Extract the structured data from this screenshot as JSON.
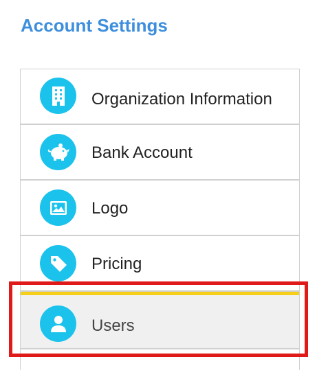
{
  "page": {
    "title": "Account Settings"
  },
  "menu": {
    "items": [
      {
        "label": "Organization Information",
        "icon": "building-icon"
      },
      {
        "label": "Bank Account",
        "icon": "piggy-bank-icon"
      },
      {
        "label": "Logo",
        "icon": "image-icon"
      },
      {
        "label": "Pricing",
        "icon": "price-tag-icon"
      },
      {
        "label": "Users",
        "icon": "user-icon",
        "selected": true
      }
    ]
  },
  "colors": {
    "title": "#3d8fde",
    "icon_circle": "#1bc3ec",
    "active_indicator": "#f6cf1a",
    "highlight_border": "#e01919",
    "active_background": "#f0f0f0"
  }
}
